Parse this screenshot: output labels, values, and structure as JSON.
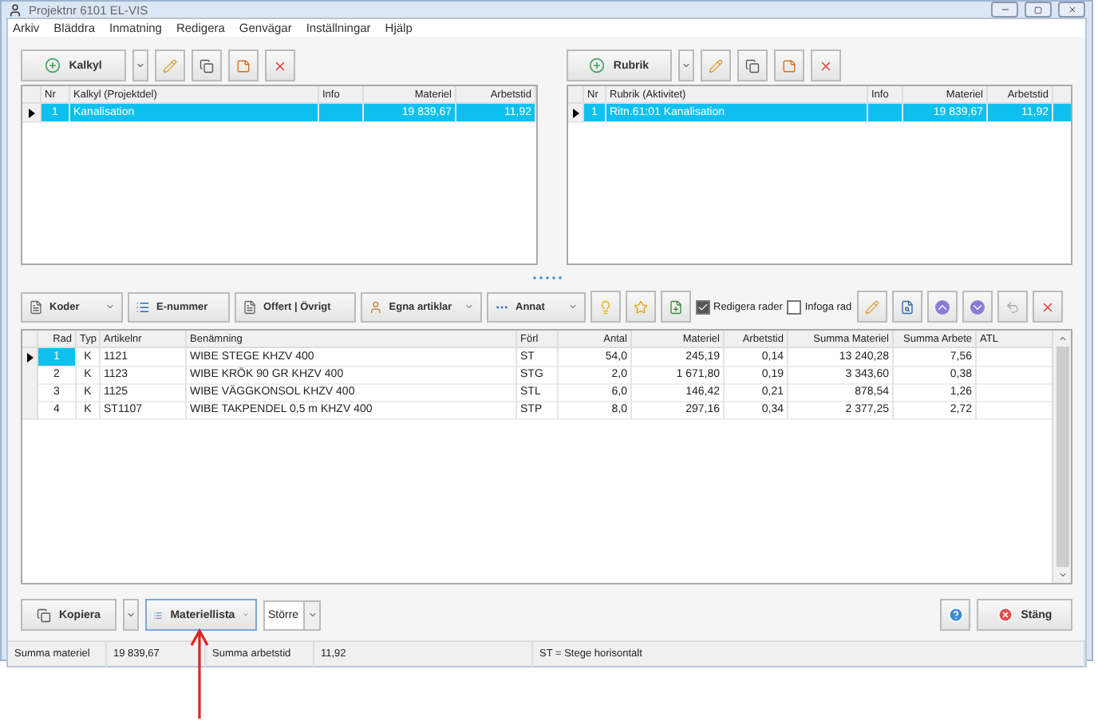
{
  "window": {
    "title": "Projektnr 6101 EL-VIS"
  },
  "menu": [
    "Arkiv",
    "Bläddra",
    "Inmatning",
    "Redigera",
    "Genvägar",
    "Inställningar",
    "Hjälp"
  ],
  "panels": [
    {
      "button": "Kalkyl",
      "columns": [
        "Nr",
        "Kalkyl (Projektdel)",
        "Info",
        "Materiel",
        "Arbetstid"
      ],
      "rows": [
        {
          "selected": true,
          "cells": [
            "1",
            "Kanalisation",
            "",
            "19 839,67",
            "11,92"
          ]
        }
      ]
    },
    {
      "button": "Rubrik",
      "columns": [
        "Nr",
        "Rubrik (Aktivitet)",
        "Info",
        "Materiel",
        "Arbetstid"
      ],
      "rows": [
        {
          "selected": true,
          "cells": [
            "1",
            "Ritn.61:01 Kanalisation",
            "",
            "19 839,67",
            "11,92"
          ]
        }
      ]
    }
  ],
  "toolbar": [
    {
      "kind": "dropdown",
      "label": "Koder"
    },
    {
      "kind": "button",
      "label": "E-nummer"
    },
    {
      "kind": "button",
      "label": "Offert | Övrigt"
    },
    {
      "kind": "dropdown",
      "label": "Egna artiklar"
    },
    {
      "kind": "dropdown",
      "label": "Annat"
    }
  ],
  "checkboxes": [
    {
      "label": "Redigera rader",
      "checked": true
    },
    {
      "label": "Infoga rad",
      "checked": false
    }
  ],
  "table": {
    "columns": [
      "Rad",
      "Typ",
      "Artikelnr",
      "Benämning",
      "Förl",
      "Antal",
      "Materiel",
      "Arbetstid",
      "Summa Materiel",
      "Summa Arbete",
      "ATL"
    ],
    "rows": [
      {
        "selected": true,
        "cells": [
          "1",
          "K",
          "1121",
          "WIBE STEGE KHZV 400",
          "ST",
          "54,0",
          "245,19",
          "0,14",
          "13 240,28",
          "7,56",
          ""
        ]
      },
      {
        "selected": false,
        "cells": [
          "2",
          "K",
          "1123",
          "WIBE KRÖK 90 GR KHZV 400",
          "STG",
          "2,0",
          "1 671,80",
          "0,19",
          "3 343,60",
          "0,38",
          ""
        ]
      },
      {
        "selected": false,
        "cells": [
          "3",
          "K",
          "1125",
          "WIBE VÄGGKONSOL KHZV 400",
          "STL",
          "6,0",
          "146,42",
          "0,21",
          "878,54",
          "1,26",
          ""
        ]
      },
      {
        "selected": false,
        "cells": [
          "4",
          "K",
          "ST1107",
          "WIBE TAKPENDEL 0,5 m KHZV 400",
          "STP",
          "8,0",
          "297,16",
          "0,34",
          "2 377,25",
          "2,72",
          ""
        ]
      }
    ]
  },
  "bottom": {
    "copy": "Kopiera",
    "list": "Materiellista",
    "size": "Större",
    "close": "Stäng"
  },
  "status_bar": [
    "Summa materiel",
    "19 839,67",
    "Summa arbetstid",
    "11,92",
    "ST = Stege horisontalt"
  ]
}
